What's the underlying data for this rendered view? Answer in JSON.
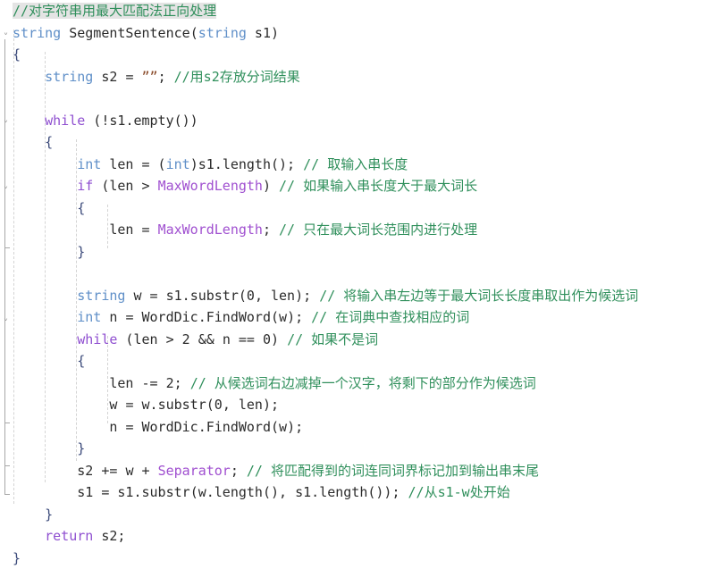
{
  "editor": {
    "language": "cpp",
    "font_size_px": 15,
    "line_height_px": 24.5,
    "background": "#ffffff",
    "selection_background": "#e4e4e4",
    "indent_guide_color": "#d4d4d4",
    "fold_gutter_color": "#a8a8a8",
    "colors": {
      "type_keyword": "#5f8fc8",
      "control_keyword": "#8f4fd0",
      "identifier": "#2b2b2b",
      "constant": "#a050d0",
      "string": "#8a4b2a",
      "comment": "#2f8f5b",
      "brace": "#3b4a7a"
    }
  },
  "gutter": {
    "fold_markers": [
      {
        "type": "chevron-down-icon",
        "line": 1
      },
      {
        "type": "chevron-down-icon",
        "line": 4
      },
      {
        "type": "chevron-down-icon",
        "line": 7
      },
      {
        "type": "end-tick",
        "line": 10
      },
      {
        "type": "chevron-down-icon",
        "line": 14
      },
      {
        "type": "end-tick",
        "line": 19
      },
      {
        "type": "end-tick",
        "line": 22
      }
    ]
  },
  "lines": [
    {
      "n": 0,
      "selected": true,
      "text": "//对字符串用最大匹配法正向处理",
      "tokens": [
        {
          "t": "cmt",
          "v": "//对字符串用最大匹配法正向处理"
        }
      ]
    },
    {
      "n": 1,
      "selected": false,
      "text": "string SegmentSentence(string s1)",
      "tokens": [
        {
          "t": "kw",
          "v": "string"
        },
        {
          "t": "ident",
          "v": " SegmentSentence"
        },
        {
          "t": "punct",
          "v": "("
        },
        {
          "t": "kw",
          "v": "string"
        },
        {
          "t": "ident",
          "v": " s1"
        },
        {
          "t": "punct",
          "v": ")"
        }
      ]
    },
    {
      "n": 2,
      "selected": false,
      "text": "{",
      "tokens": [
        {
          "t": "brace",
          "v": "{"
        }
      ]
    },
    {
      "n": 3,
      "selected": false,
      "text": "    string s2 = ””; //用s2存放分词结果",
      "tokens": [
        {
          "t": "ind",
          "v": "    "
        },
        {
          "t": "kw",
          "v": "string"
        },
        {
          "t": "ident",
          "v": " s2 "
        },
        {
          "t": "punct",
          "v": "= "
        },
        {
          "t": "str",
          "v": "””"
        },
        {
          "t": "punct",
          "v": "; "
        },
        {
          "t": "cmt",
          "v": "//用s2存放分词结果"
        }
      ]
    },
    {
      "n": 4,
      "selected": false,
      "text": "",
      "tokens": []
    },
    {
      "n": 5,
      "selected": false,
      "text": "    while (!s1.empty())",
      "tokens": [
        {
          "t": "ind",
          "v": "    "
        },
        {
          "t": "ctrl",
          "v": "while"
        },
        {
          "t": "punct",
          "v": " (!"
        },
        {
          "t": "ident",
          "v": "s1"
        },
        {
          "t": "punct",
          "v": "."
        },
        {
          "t": "ident",
          "v": "empty"
        },
        {
          "t": "punct",
          "v": "())"
        }
      ]
    },
    {
      "n": 6,
      "selected": false,
      "text": "    {",
      "tokens": [
        {
          "t": "ind",
          "v": "    "
        },
        {
          "t": "brace",
          "v": "{"
        }
      ]
    },
    {
      "n": 7,
      "selected": false,
      "text": "        int len = (int)s1.length(); // 取输入串长度",
      "tokens": [
        {
          "t": "ind",
          "v": "        "
        },
        {
          "t": "kw",
          "v": "int"
        },
        {
          "t": "ident",
          "v": " len "
        },
        {
          "t": "punct",
          "v": "= ("
        },
        {
          "t": "kw",
          "v": "int"
        },
        {
          "t": "punct",
          "v": ")"
        },
        {
          "t": "ident",
          "v": "s1"
        },
        {
          "t": "punct",
          "v": "."
        },
        {
          "t": "ident",
          "v": "length"
        },
        {
          "t": "punct",
          "v": "(); "
        },
        {
          "t": "cmt",
          "v": "// 取输入串长度"
        }
      ]
    },
    {
      "n": 8,
      "selected": false,
      "text": "        if (len > MaxWordLength) // 如果输入串长度大于最大词长",
      "tokens": [
        {
          "t": "ind",
          "v": "        "
        },
        {
          "t": "ctrl",
          "v": "if"
        },
        {
          "t": "punct",
          "v": " ("
        },
        {
          "t": "ident",
          "v": "len "
        },
        {
          "t": "punct",
          "v": "> "
        },
        {
          "t": "const",
          "v": "MaxWordLength"
        },
        {
          "t": "punct",
          "v": ") "
        },
        {
          "t": "cmt",
          "v": "// 如果输入串长度大于最大词长"
        }
      ]
    },
    {
      "n": 9,
      "selected": false,
      "text": "        {",
      "tokens": [
        {
          "t": "ind",
          "v": "        "
        },
        {
          "t": "brace",
          "v": "{"
        }
      ]
    },
    {
      "n": 10,
      "selected": false,
      "text": "            len = MaxWordLength; // 只在最大词长范围内进行处理",
      "tokens": [
        {
          "t": "ind",
          "v": "            "
        },
        {
          "t": "ident",
          "v": "len "
        },
        {
          "t": "punct",
          "v": "= "
        },
        {
          "t": "const",
          "v": "MaxWordLength"
        },
        {
          "t": "punct",
          "v": "; "
        },
        {
          "t": "cmt",
          "v": "// 只在最大词长范围内进行处理"
        }
      ]
    },
    {
      "n": 11,
      "selected": false,
      "text": "        }",
      "tokens": [
        {
          "t": "ind",
          "v": "        "
        },
        {
          "t": "brace",
          "v": "}"
        }
      ]
    },
    {
      "n": 12,
      "selected": false,
      "text": "",
      "tokens": []
    },
    {
      "n": 13,
      "selected": false,
      "text": "        string w = s1.substr(0, len); // 将输入串左边等于最大词长长度串取出作为候选词",
      "tokens": [
        {
          "t": "ind",
          "v": "        "
        },
        {
          "t": "kw",
          "v": "string"
        },
        {
          "t": "ident",
          "v": " w "
        },
        {
          "t": "punct",
          "v": "= "
        },
        {
          "t": "ident",
          "v": "s1"
        },
        {
          "t": "punct",
          "v": "."
        },
        {
          "t": "ident",
          "v": "substr"
        },
        {
          "t": "punct",
          "v": "("
        },
        {
          "t": "num",
          "v": "0"
        },
        {
          "t": "punct",
          "v": ", "
        },
        {
          "t": "ident",
          "v": "len"
        },
        {
          "t": "punct",
          "v": "); "
        },
        {
          "t": "cmt",
          "v": "// 将输入串左边等于最大词长长度串取出作为候选词"
        }
      ]
    },
    {
      "n": 14,
      "selected": false,
      "text": "        int n = WordDic.FindWord(w); // 在词典中查找相应的词",
      "tokens": [
        {
          "t": "ind",
          "v": "        "
        },
        {
          "t": "kw",
          "v": "int"
        },
        {
          "t": "ident",
          "v": " n "
        },
        {
          "t": "punct",
          "v": "= "
        },
        {
          "t": "ident",
          "v": "WordDic"
        },
        {
          "t": "punct",
          "v": "."
        },
        {
          "t": "ident",
          "v": "FindWord"
        },
        {
          "t": "punct",
          "v": "("
        },
        {
          "t": "ident",
          "v": "w"
        },
        {
          "t": "punct",
          "v": "); "
        },
        {
          "t": "cmt",
          "v": "// 在词典中查找相应的词"
        }
      ]
    },
    {
      "n": 15,
      "selected": false,
      "text": "        while (len > 2 && n == 0) // 如果不是词",
      "tokens": [
        {
          "t": "ind",
          "v": "        "
        },
        {
          "t": "ctrl",
          "v": "while"
        },
        {
          "t": "punct",
          "v": " ("
        },
        {
          "t": "ident",
          "v": "len "
        },
        {
          "t": "punct",
          "v": "> "
        },
        {
          "t": "num",
          "v": "2"
        },
        {
          "t": "punct",
          "v": " && "
        },
        {
          "t": "ident",
          "v": "n "
        },
        {
          "t": "punct",
          "v": "== "
        },
        {
          "t": "num",
          "v": "0"
        },
        {
          "t": "punct",
          "v": ") "
        },
        {
          "t": "cmt",
          "v": "// 如果不是词"
        }
      ]
    },
    {
      "n": 16,
      "selected": false,
      "text": "        {",
      "tokens": [
        {
          "t": "ind",
          "v": "        "
        },
        {
          "t": "brace",
          "v": "{"
        }
      ]
    },
    {
      "n": 17,
      "selected": false,
      "text": "            len -= 2; // 从候选词右边减掉一个汉字，将剩下的部分作为候选词",
      "tokens": [
        {
          "t": "ind",
          "v": "            "
        },
        {
          "t": "ident",
          "v": "len "
        },
        {
          "t": "punct",
          "v": "-= "
        },
        {
          "t": "num",
          "v": "2"
        },
        {
          "t": "punct",
          "v": "; "
        },
        {
          "t": "cmt",
          "v": "// 从候选词右边减掉一个汉字，将剩下的部分作为候选词"
        }
      ]
    },
    {
      "n": 18,
      "selected": false,
      "text": "            w = w.substr(0, len);",
      "tokens": [
        {
          "t": "ind",
          "v": "            "
        },
        {
          "t": "ident",
          "v": "w "
        },
        {
          "t": "punct",
          "v": "= "
        },
        {
          "t": "ident",
          "v": "w"
        },
        {
          "t": "punct",
          "v": "."
        },
        {
          "t": "ident",
          "v": "substr"
        },
        {
          "t": "punct",
          "v": "("
        },
        {
          "t": "num",
          "v": "0"
        },
        {
          "t": "punct",
          "v": ", "
        },
        {
          "t": "ident",
          "v": "len"
        },
        {
          "t": "punct",
          "v": ");"
        }
      ]
    },
    {
      "n": 19,
      "selected": false,
      "text": "            n = WordDic.FindWord(w);",
      "tokens": [
        {
          "t": "ind",
          "v": "            "
        },
        {
          "t": "ident",
          "v": "n "
        },
        {
          "t": "punct",
          "v": "= "
        },
        {
          "t": "ident",
          "v": "WordDic"
        },
        {
          "t": "punct",
          "v": "."
        },
        {
          "t": "ident",
          "v": "FindWord"
        },
        {
          "t": "punct",
          "v": "("
        },
        {
          "t": "ident",
          "v": "w"
        },
        {
          "t": "punct",
          "v": ");"
        }
      ]
    },
    {
      "n": 20,
      "selected": false,
      "text": "        }",
      "tokens": [
        {
          "t": "ind",
          "v": "        "
        },
        {
          "t": "brace",
          "v": "}"
        }
      ]
    },
    {
      "n": 21,
      "selected": false,
      "text": "        s2 += w + Separator; // 将匹配得到的词连同词界标记加到输出串末尾",
      "tokens": [
        {
          "t": "ind",
          "v": "        "
        },
        {
          "t": "ident",
          "v": "s2 "
        },
        {
          "t": "punct",
          "v": "+= "
        },
        {
          "t": "ident",
          "v": "w "
        },
        {
          "t": "punct",
          "v": "+ "
        },
        {
          "t": "const",
          "v": "Separator"
        },
        {
          "t": "punct",
          "v": "; "
        },
        {
          "t": "cmt",
          "v": "// 将匹配得到的词连同词界标记加到输出串末尾"
        }
      ]
    },
    {
      "n": 22,
      "selected": false,
      "text": "        s1 = s1.substr(w.length(), s1.length()); //从s1-w处开始",
      "tokens": [
        {
          "t": "ind",
          "v": "        "
        },
        {
          "t": "ident",
          "v": "s1 "
        },
        {
          "t": "punct",
          "v": "= "
        },
        {
          "t": "ident",
          "v": "s1"
        },
        {
          "t": "punct",
          "v": "."
        },
        {
          "t": "ident",
          "v": "substr"
        },
        {
          "t": "punct",
          "v": "("
        },
        {
          "t": "ident",
          "v": "w"
        },
        {
          "t": "punct",
          "v": "."
        },
        {
          "t": "ident",
          "v": "length"
        },
        {
          "t": "punct",
          "v": "(), "
        },
        {
          "t": "ident",
          "v": "s1"
        },
        {
          "t": "punct",
          "v": "."
        },
        {
          "t": "ident",
          "v": "length"
        },
        {
          "t": "punct",
          "v": "()); "
        },
        {
          "t": "cmt",
          "v": "//从s1-w处开始"
        }
      ]
    },
    {
      "n": 23,
      "selected": false,
      "text": "    }",
      "tokens": [
        {
          "t": "ind",
          "v": "    "
        },
        {
          "t": "brace",
          "v": "}"
        }
      ]
    },
    {
      "n": 24,
      "selected": false,
      "text": "    return s2;",
      "tokens": [
        {
          "t": "ind",
          "v": "    "
        },
        {
          "t": "ctrl",
          "v": "return"
        },
        {
          "t": "ident",
          "v": " s2"
        },
        {
          "t": "punct",
          "v": ";"
        }
      ]
    },
    {
      "n": 25,
      "selected": false,
      "text": "}",
      "tokens": [
        {
          "t": "brace",
          "v": "}"
        }
      ]
    }
  ]
}
